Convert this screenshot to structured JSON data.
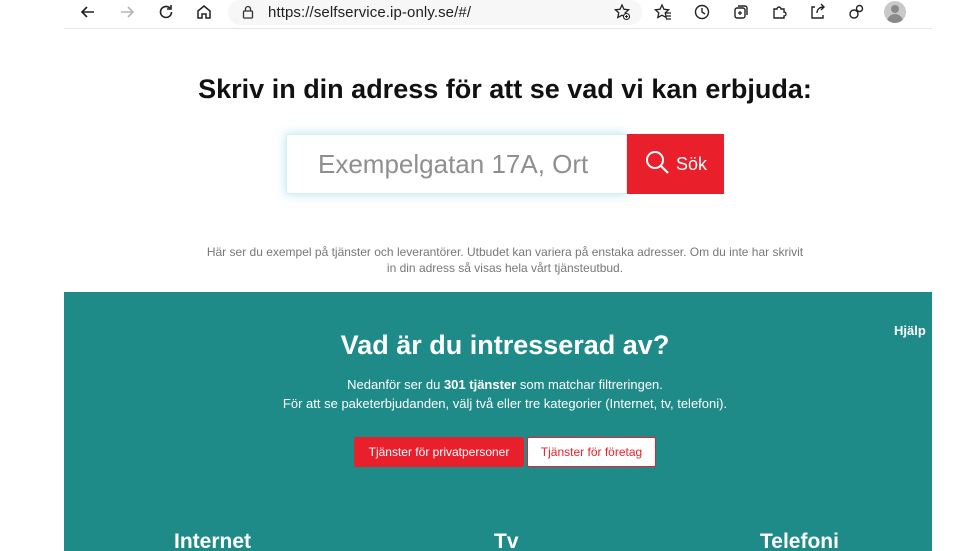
{
  "browser": {
    "url": "https://selfservice.ip-only.se/#/",
    "icons": [
      "back-icon",
      "forward-icon",
      "reload-icon",
      "home-icon",
      "lock-icon",
      "favorite-add-icon",
      "favorites-icon",
      "history-icon",
      "collections-icon",
      "extensions-icon",
      "share-icon",
      "settings-icon",
      "profile-avatar"
    ]
  },
  "hero": {
    "title": "Skriv in din adress för att se vad vi kan erbjuda:",
    "search_placeholder": "Exempelgatan 17A, Ort",
    "search_button": "Sök",
    "disclaimer_line1": "Här ser du exempel på tjänster och leverantörer. Utbudet kan variera på enstaka adresser. Om du inte har skrivit",
    "disclaimer_line2": "in din adress så visas hela vårt tjänsteutbud."
  },
  "services": {
    "help": "Hjälp",
    "title": "Vad är du intresserad av?",
    "desc_prefix": "Nedanför ser du",
    "desc_count": "301 tjänster",
    "desc_suffix": "som matchar filtreringen.",
    "desc_line2": "För att se paketerbjudanden, välj två eller tre kategorier (Internet, tv, telefoni).",
    "tab_private": "Tjänster för privatpersoner",
    "tab_business": "Tjänster för företag",
    "categories": [
      "Internet",
      "Tv",
      "Telefoni"
    ]
  },
  "colors": {
    "accent_red": "#e9202c",
    "teal": "#1e8b88"
  }
}
